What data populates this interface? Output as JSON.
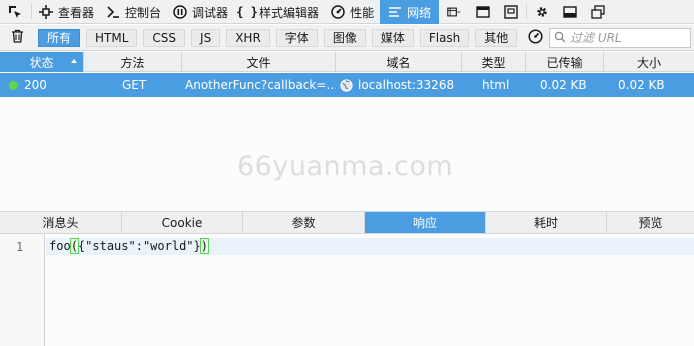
{
  "toolbar": {
    "tools": [
      {
        "label": "",
        "icon": "element-picker-icon"
      },
      {
        "label": "查看器",
        "icon": "inspector-icon"
      },
      {
        "label": "控制台",
        "icon": "console-icon"
      },
      {
        "label": "调试器",
        "icon": "debugger-icon"
      },
      {
        "label": "样式编辑器",
        "icon": "style-editor-icon"
      },
      {
        "label": "性能",
        "icon": "performance-icon"
      },
      {
        "label": "网络",
        "icon": "network-icon",
        "active": true
      }
    ],
    "right_icons": [
      "responsive-design-icon",
      "console-split-icon",
      "screenshot-icon",
      "settings-icon",
      "dock-bottom-icon",
      "dock-window-icon"
    ]
  },
  "filters": {
    "buttons": [
      "所有",
      "HTML",
      "CSS",
      "JS",
      "XHR",
      "字体",
      "图像",
      "媒体",
      "Flash",
      "其他"
    ],
    "active": "所有",
    "placeholder": "过滤 URL"
  },
  "table": {
    "columns": [
      "状态",
      "方法",
      "文件",
      "域名",
      "类型",
      "已传输",
      "大小"
    ],
    "sorted_column": "状态",
    "rows": [
      {
        "status": "200",
        "method": "GET",
        "file": "AnotherFunc?callback=…",
        "domain": "localhost:33268",
        "type": "html",
        "transferred": "0.02 KB",
        "size": "0.02 KB"
      }
    ]
  },
  "watermark": "66yuanma.com",
  "details": {
    "tabs": [
      "消息头",
      "Cookie",
      "参数",
      "响应",
      "耗时",
      "预览"
    ],
    "active_tab": "响应"
  },
  "editor": {
    "line_number": "1",
    "code_prefix": "foo",
    "code_open": "(",
    "code_body": "{\"staus\":\"world\"}",
    "code_close": ")"
  },
  "colors": {
    "accent": "#4b9de2",
    "status_ok": "#63d34b",
    "background": "#fcfcfc",
    "toolbar": "#f0f1f2"
  }
}
